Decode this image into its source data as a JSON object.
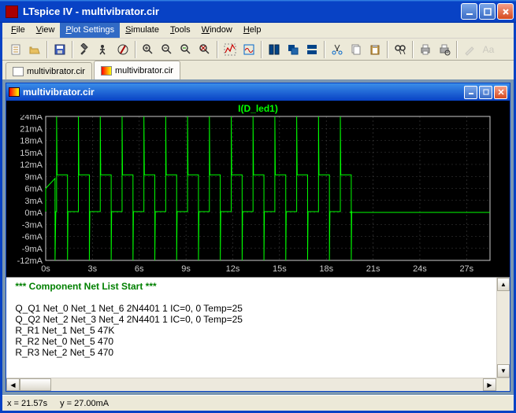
{
  "app": {
    "title": "LTspice IV - multivibrator.cir"
  },
  "menu": [
    "File",
    "View",
    "Plot Settings",
    "Simulate",
    "Tools",
    "Window",
    "Help"
  ],
  "menu_active_index": 2,
  "tabs": [
    {
      "label": "multivibrator.cir",
      "type": "scm"
    },
    {
      "label": "multivibrator.cir",
      "type": "plt",
      "active": true
    }
  ],
  "child": {
    "title": "multivibrator.cir"
  },
  "chart_data": {
    "type": "line",
    "title": "I(D_led1)",
    "xlabel": "",
    "ylabel": "",
    "xlim": [
      0,
      28.5
    ],
    "ylim": [
      -12,
      24
    ],
    "x_ticks": [
      "0s",
      "3s",
      "6s",
      "9s",
      "12s",
      "15s",
      "18s",
      "21s",
      "24s",
      "27s"
    ],
    "y_ticks": [
      "24mA",
      "21mA",
      "18mA",
      "15mA",
      "12mA",
      "9mA",
      "6mA",
      "3mA",
      "0mA",
      "-3mA",
      "-6mA",
      "-9mA",
      "-12mA"
    ],
    "series": [
      {
        "name": "I(D_led1)",
        "color": "#00ff00",
        "description": "square-like oscillation ~1.4s period between ~0.2mA and 9.4mA with +/- spikes to ~24mA/-12mA on edges, decays to 0mA after ~19.5s",
        "x": [
          0,
          0.7,
          1.4,
          2.1,
          2.8,
          3.5,
          4.2,
          4.9,
          5.6,
          6.3,
          7.0,
          7.7,
          8.4,
          9.1,
          9.8,
          10.5,
          11.2,
          11.9,
          12.6,
          13.3,
          14.0,
          14.7,
          15.4,
          16.1,
          16.8,
          17.5,
          18.2,
          18.9,
          19.5,
          28.5
        ],
        "y": [
          0.2,
          9.4,
          0.2,
          9.4,
          0.2,
          9.4,
          0.2,
          9.4,
          0.2,
          9.4,
          0.2,
          9.4,
          0.2,
          9.4,
          0.2,
          9.4,
          0.2,
          9.4,
          0.2,
          9.4,
          0.2,
          9.4,
          0.2,
          9.4,
          0.2,
          9.4,
          0.2,
          9.4,
          0,
          0
        ]
      }
    ]
  },
  "netlist": {
    "header": "*** Component Net List Start ***",
    "lines": [
      "",
      "Q_Q1 Net_0 Net_1 Net_6 2N4401 1 IC=0, 0 Temp=25",
      "Q_Q2 Net_2 Net_3 Net_4 2N4401 1 IC=0, 0 Temp=25",
      "R_R1 Net_1 Net_5 47K",
      "R_R2 Net_0 Net_5 470",
      "R_R3 Net_2 Net_5 470"
    ]
  },
  "status": {
    "x": "x = 21.57s",
    "y": "y = 27.00mA"
  },
  "colors": {
    "accent": "#0842c5",
    "grid": "#555",
    "plot_bg": "#000",
    "trace": "#00ff00",
    "axis": "#cccccc"
  }
}
